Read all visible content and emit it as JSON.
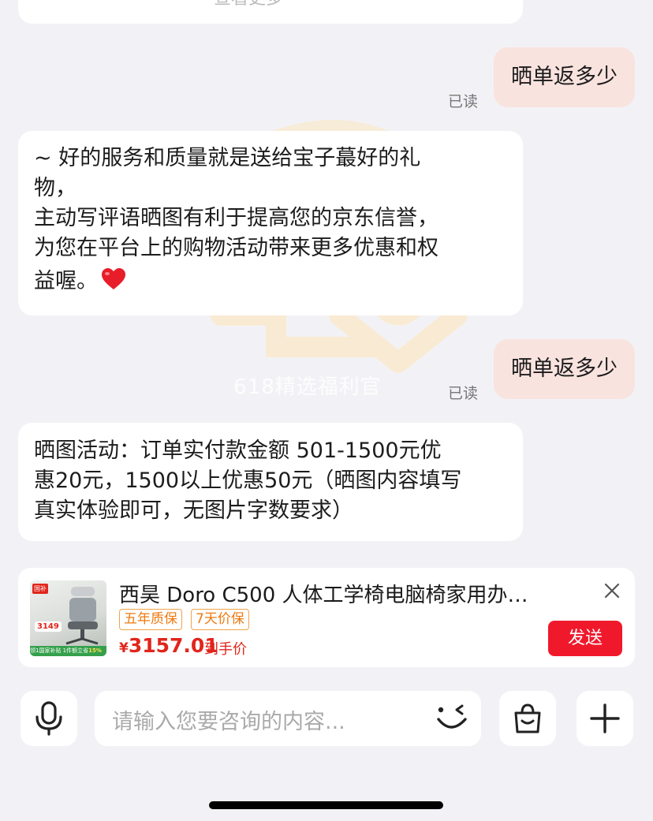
{
  "chat": {
    "watermark": "618精选福利官",
    "top_partial_text": "查看更多",
    "messages": [
      {
        "side": "out",
        "text": "晒单返多少",
        "status": "已读"
      },
      {
        "side": "in",
        "lines": [
          "~ 好的服务和质量就是送给宝子蕞好的礼",
          "物，",
          "主动写评语晒图有利于提高您的京东信誉，",
          "为您在平台上的购物活动带来更多优惠和权",
          "益喔。"
        ]
      },
      {
        "side": "out",
        "text": "晒单返多少",
        "status": "已读"
      },
      {
        "side": "in",
        "lines": [
          "晒图活动：订单实付款金额  501-1500元优",
          "惠20元，1500以上优惠50元（晒图内容填写",
          "真实体验即可，无图片字数要求）"
        ]
      }
    ]
  },
  "product_card": {
    "title": "西昊 Doro C500 人体工学椅电脑椅家用办…",
    "tags": [
      "五年质保",
      "7天价保"
    ],
    "currency": "¥",
    "price": "3157.01",
    "price_label": "到手价",
    "send_label": "发送",
    "thumb_badge": "国补",
    "thumb_price": "3149",
    "thumb_banner_text": "领1国家补贴 1件额立省",
    "thumb_banner_discount": "15%"
  },
  "input_bar": {
    "placeholder": "请输入您要咨询的内容...",
    "icons": [
      "microphone-icon",
      "emoji-wink-icon",
      "shopping-bag-icon",
      "plus-icon"
    ]
  },
  "colors": {
    "accent": "#f0192c",
    "bubble_out": "#f9e3df",
    "price": "#e1251b",
    "tag": "#ee7a10"
  }
}
